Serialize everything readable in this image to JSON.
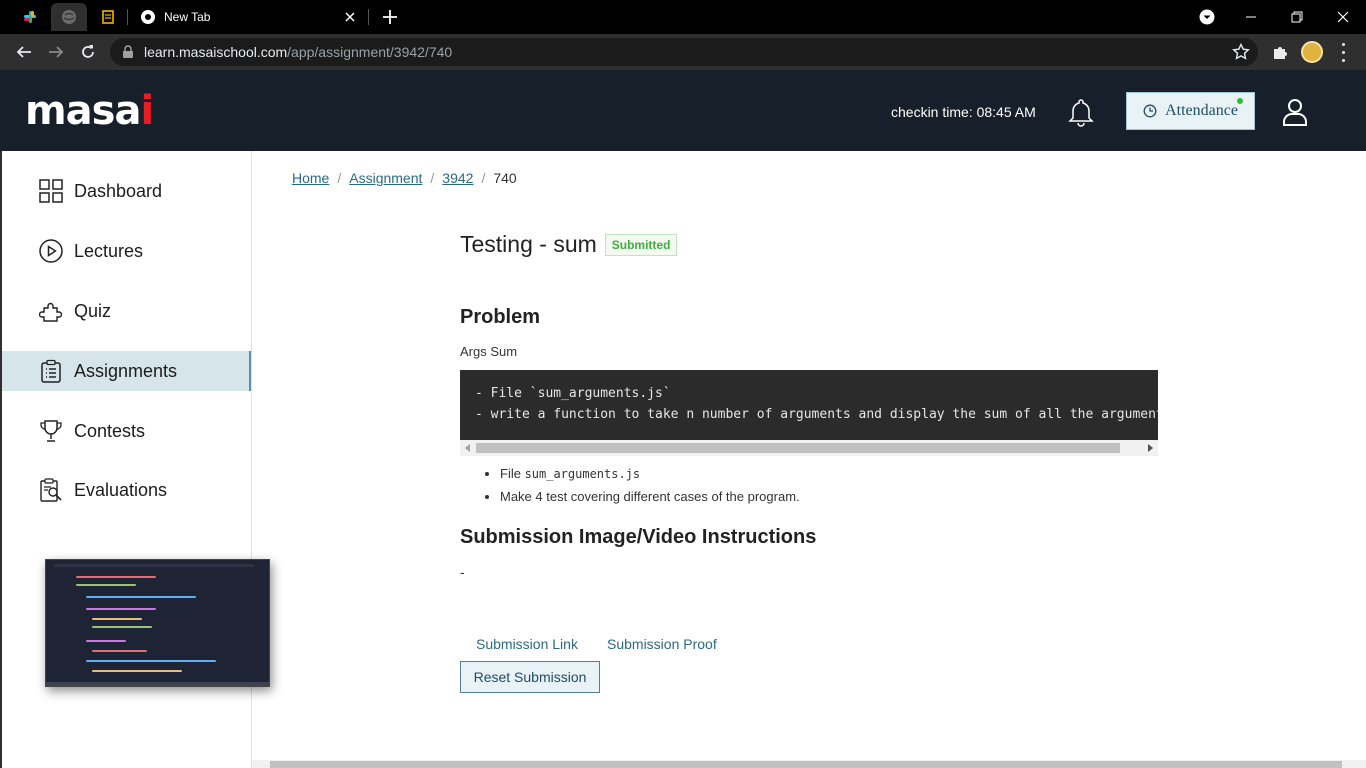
{
  "browser": {
    "tabs": [
      {
        "name": "slack"
      },
      {
        "name": "active-pinned"
      },
      {
        "name": "bookmark-app"
      }
    ],
    "active_tab_title": "New Tab",
    "url_domain": "learn.masaischool.com",
    "url_path": "/app/assignment/3942/740"
  },
  "header": {
    "logo_text": "masai",
    "checkin": "checkin time: 08:45 AM",
    "attendance_label": "Attendance"
  },
  "sidebar": {
    "items": [
      {
        "label": "Dashboard",
        "icon": "grid-icon"
      },
      {
        "label": "Lectures",
        "icon": "play-circle-icon"
      },
      {
        "label": "Quiz",
        "icon": "puzzle-icon"
      },
      {
        "label": "Assignments",
        "icon": "clipboard-icon",
        "active": true
      },
      {
        "label": "Contests",
        "icon": "trophy-icon"
      },
      {
        "label": "Evaluations",
        "icon": "report-search-icon"
      }
    ]
  },
  "breadcrumb": {
    "home": "Home",
    "assignment": "Assignment",
    "id": "3942",
    "current": "740"
  },
  "assignment": {
    "title": "Testing - sum",
    "status": "Submitted",
    "problem_heading": "Problem",
    "problem_name": "Args Sum",
    "code_lines": [
      "- File `sum_arguments.js`",
      "- write a function to take n number of arguments and display the sum of all the arguments"
    ],
    "bullets": {
      "file_prefix": "File ",
      "file_name": "sum_arguments.js",
      "test_note": "Make 4 test covering different cases of the program."
    },
    "submission_heading": "Submission Image/Video Instructions",
    "submission_text": "-",
    "submission_link": "Submission Link",
    "submission_proof": "Submission Proof",
    "reset_label": "Reset Submission"
  },
  "colors": {
    "header_bg": "#17202a",
    "accent": "#2b6a83",
    "active_sidebar": "#d5e5ea",
    "status_green": "#3fae3f",
    "logo_dot": "#ed1c24"
  }
}
